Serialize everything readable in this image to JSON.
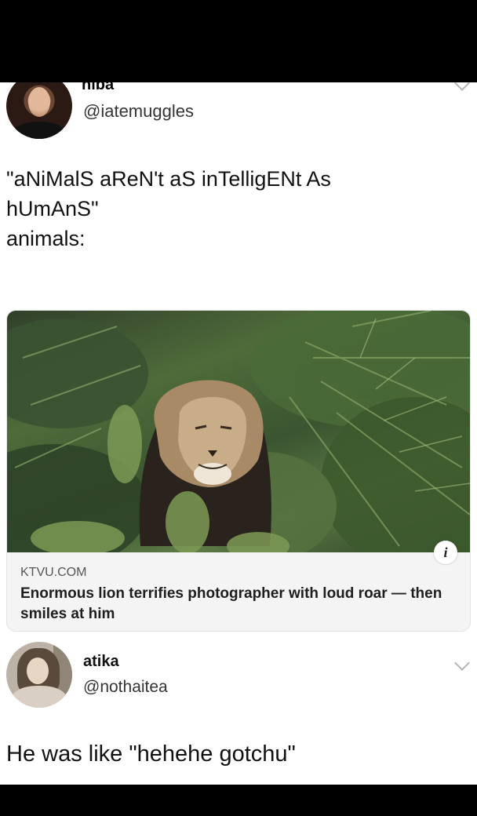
{
  "tweet": {
    "name": "hiba",
    "handle": "@iatemuggles",
    "lines": [
      "\"aNiMalS aReN't aS inTelligENt As",
      "hUmAnS\"",
      "animals:"
    ]
  },
  "card": {
    "domain": "KTVU.COM",
    "title": "Enormous lion terrifies photographer with loud roar — then smiles at him",
    "info_icon": "i"
  },
  "reply": {
    "name": "atika",
    "handle": "@nothaitea",
    "text": "He was like \"hehehe gotchu\""
  },
  "icons": {
    "menu": "chevron-down-icon",
    "info": "info-icon"
  }
}
